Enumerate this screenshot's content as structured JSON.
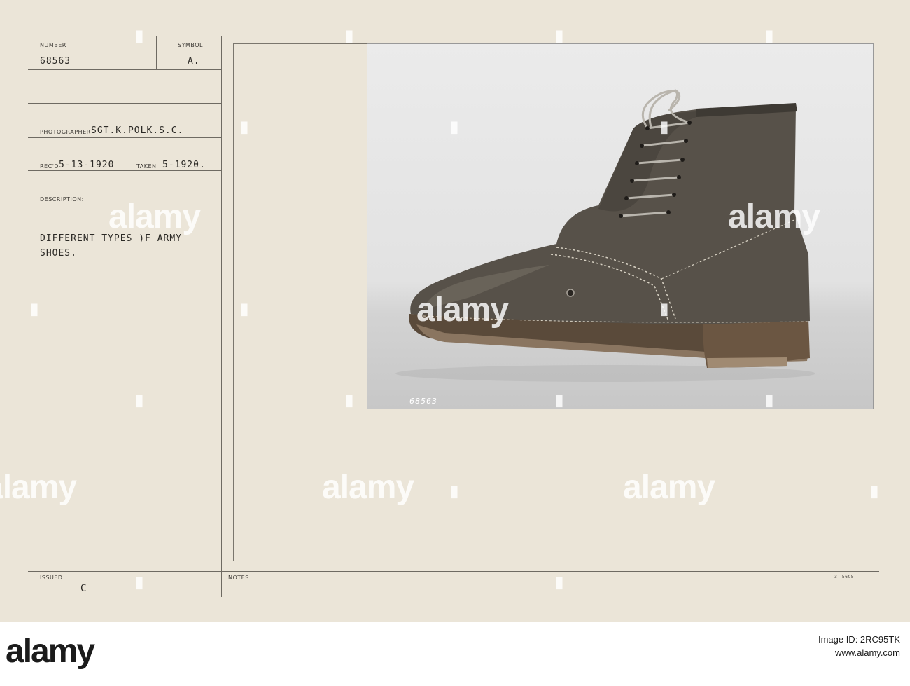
{
  "card": {
    "number_label": "NUMBER",
    "number_value": "68563",
    "symbol_label": "SYMBOL",
    "symbol_value": "A.",
    "photographer_label": "PHOTOGRAPHER",
    "photographer_value": "SGT.K.POLK.S.C.",
    "recd_label": "REC'D",
    "recd_value": "5-13-1920",
    "taken_label": "TAKEN",
    "taken_value": "5-1920.",
    "description_label": "DESCRIPTION:",
    "description_line1": "DIFFERENT TYPES )F ARMY",
    "description_line2": "SHOES.",
    "issued_label": "ISSUED:",
    "issued_value": "C",
    "notes_label": "NOTES:",
    "form_code": "3—5605"
  },
  "photo": {
    "caption_number": "68563",
    "subject": "army-shoe"
  },
  "watermark": {
    "text": "alamy"
  },
  "footer": {
    "logo": "alamy",
    "line1": "Image ID: 2RC95TK",
    "line2": "www.alamy.com",
    "line3": ""
  },
  "colors": {
    "card_background": "#ebe5d8",
    "rule_lines": "#6e6a62",
    "ink": "#2c2a26"
  }
}
